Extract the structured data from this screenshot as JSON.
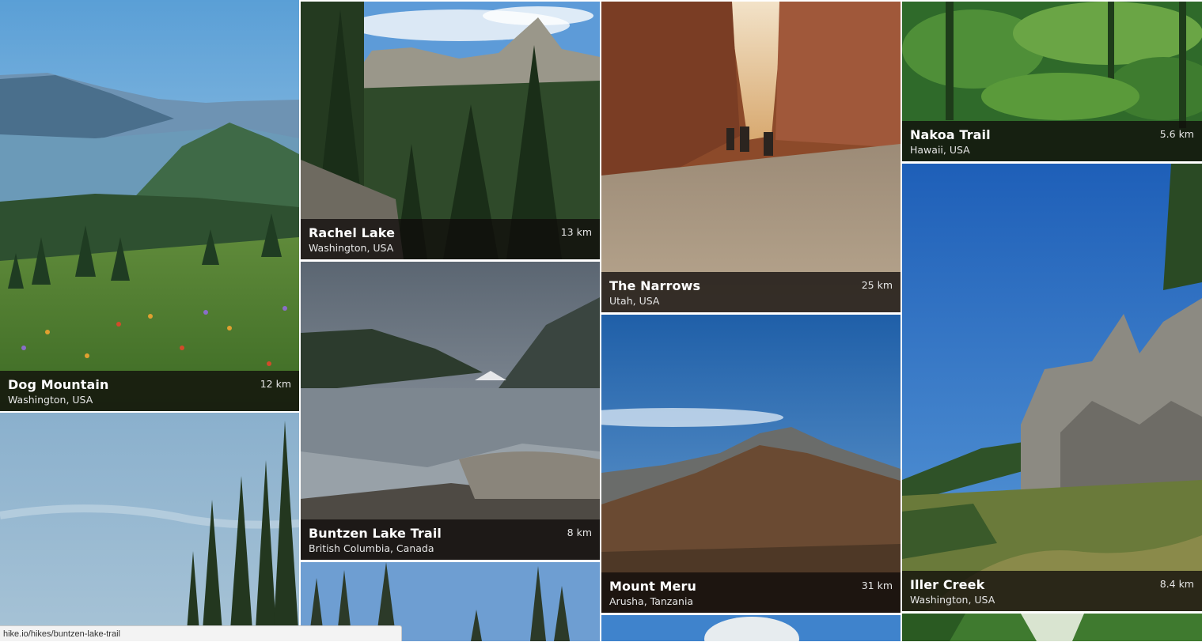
{
  "hikes": [
    {
      "name": "Dog Mountain",
      "location": "Washington, USA",
      "distance": "12 km"
    },
    {
      "name": "Rachel Lake",
      "location": "Washington, USA",
      "distance": "13 km"
    },
    {
      "name": "The Narrows",
      "location": "Utah, USA",
      "distance": "25 km"
    },
    {
      "name": "Nakoa Trail",
      "location": "Hawaii, USA",
      "distance": "5.6 km"
    },
    {
      "name": "Buntzen Lake Trail",
      "location": "British Columbia, Canada",
      "distance": "8 km"
    },
    {
      "name": "Mount Meru",
      "location": "Arusha, Tanzania",
      "distance": "31 km"
    },
    {
      "name": "Iller Creek",
      "location": "Washington, USA",
      "distance": "8.4 km"
    }
  ],
  "status_bar": {
    "url": "hike.io/hikes/buntzen-lake-trail"
  }
}
